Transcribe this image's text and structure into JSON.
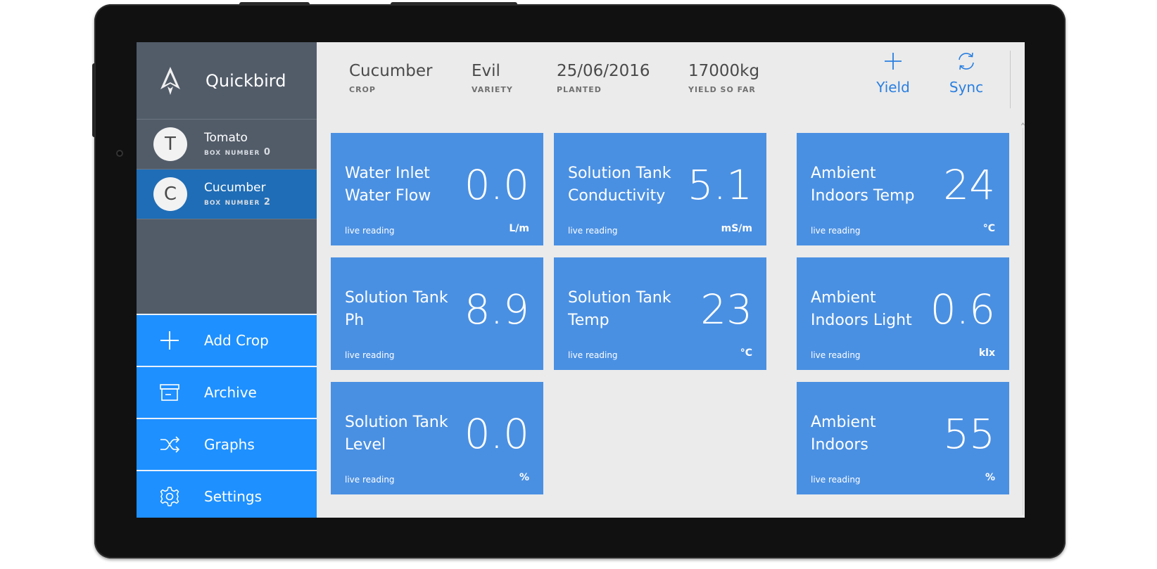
{
  "app": {
    "name": "Quickbird"
  },
  "sidebar": {
    "crops": [
      {
        "initial": "T",
        "name": "Tomato",
        "box": "box number 0",
        "active": false
      },
      {
        "initial": "C",
        "name": "Cucumber",
        "box": "box number 2",
        "active": true
      }
    ],
    "nav": [
      {
        "label": "Add Crop",
        "icon": "plus-icon"
      },
      {
        "label": "Archive",
        "icon": "archive-icon"
      },
      {
        "label": "Graphs",
        "icon": "shuffle-icon"
      },
      {
        "label": "Settings",
        "icon": "gear-icon"
      }
    ]
  },
  "header": {
    "crop": {
      "value": "Cucumber",
      "label": "CROP"
    },
    "variety": {
      "value": "Evil",
      "label": "VARIETY"
    },
    "planted": {
      "value": "25/06/2016",
      "label": "PLANTED"
    },
    "yield": {
      "value": "17000kg",
      "label": "YIELD SO FAR"
    },
    "actions": {
      "yield_label": "Yield",
      "sync_label": "Sync"
    }
  },
  "tiles": [
    {
      "title": "Water Inlet Water Flow",
      "value": "0.0",
      "sub": "live reading",
      "unit": "L/m"
    },
    {
      "title": "Solution Tank Conductivity",
      "value": "5.1",
      "sub": "live reading",
      "unit": "mS/m"
    },
    {
      "title": "Ambient Indoors Temp",
      "value": "24",
      "sub": "live reading",
      "unit": "°C"
    },
    {
      "title": "Solution Tank Ph",
      "value": "8.9",
      "sub": "live reading",
      "unit": ""
    },
    {
      "title": "Solution Tank Temp",
      "value": "23",
      "sub": "live reading",
      "unit": "°C"
    },
    {
      "title": "Ambient Indoors Light",
      "value": "0.6",
      "sub": "live reading",
      "unit": "klx"
    },
    {
      "title": "Solution Tank Level",
      "value": "0.0",
      "sub": "live reading",
      "unit": "%"
    },
    {
      "title": "Ambient Indoors",
      "value": "55",
      "sub": "live reading",
      "unit": "%"
    }
  ],
  "colors": {
    "sidebar": "#525c69",
    "active_crop": "#1f6db6",
    "nav_button": "#1e90ff",
    "tile": "#4a90e2",
    "accent": "#2a7fe0",
    "content_bg": "#ebebeb"
  }
}
